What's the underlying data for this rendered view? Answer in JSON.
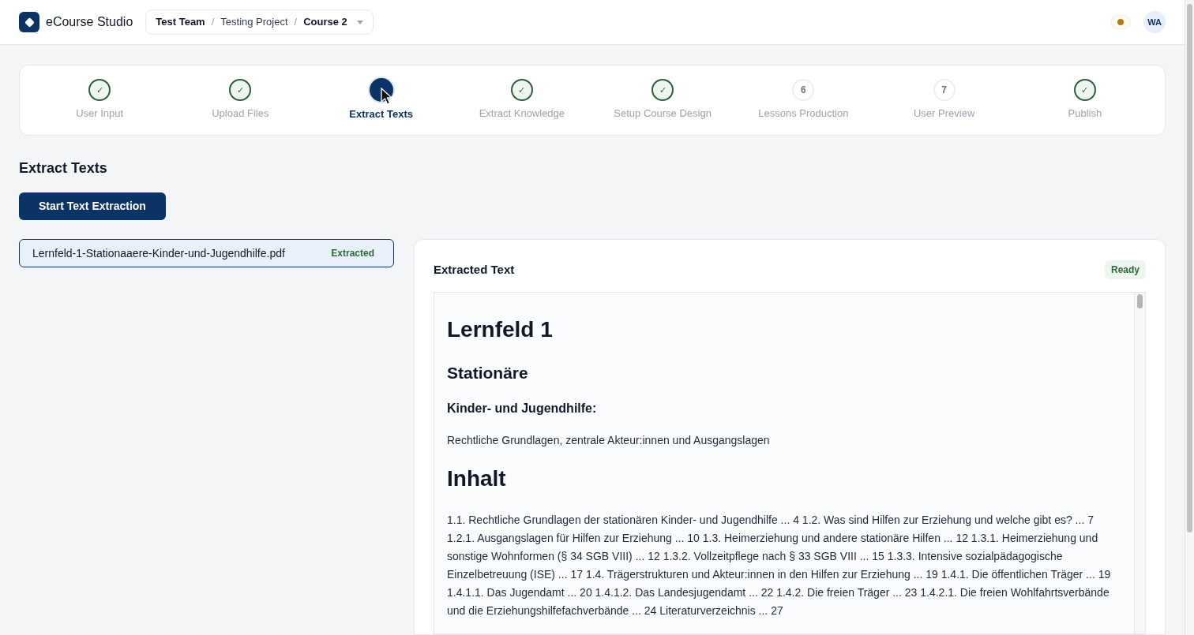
{
  "app": {
    "name": "eCourse Studio"
  },
  "breadcrumb": [
    {
      "kind": "crumb",
      "label": "Test Team",
      "bold": true
    },
    {
      "kind": "separator",
      "label": "/"
    },
    {
      "kind": "crumb",
      "label": "Testing Project",
      "bold": false
    },
    {
      "kind": "separator",
      "label": "/"
    },
    {
      "kind": "crumb",
      "label": "Course 2",
      "bold": true
    }
  ],
  "user": {
    "initials": "WA"
  },
  "steps": [
    {
      "label": "User Input",
      "kind": "done",
      "mark": "✓",
      "selected": false
    },
    {
      "label": "Upload Files",
      "kind": "done",
      "mark": "✓",
      "selected": false
    },
    {
      "label": "Extract Texts",
      "kind": "current",
      "selected": true
    },
    {
      "label": "Extract Knowledge",
      "kind": "done",
      "mark": "✓",
      "selected": false
    },
    {
      "label": "Setup Course Design",
      "kind": "done",
      "mark": "✓",
      "selected": false
    },
    {
      "label": "Lessons Production",
      "kind": "todo",
      "mark": "6",
      "selected": false
    },
    {
      "label": "User Preview",
      "kind": "todo",
      "mark": "7",
      "selected": false
    },
    {
      "label": "Publish",
      "kind": "done",
      "mark": "✓",
      "selected": false
    }
  ],
  "page_title": "Extract Texts",
  "primary_button": "Start Text Extraction",
  "files": [
    {
      "name": "Lernfeld-1-Stationaaere-Kinder-und-Jugendhilfe.pdf",
      "badge": "Extracted",
      "selected": true
    }
  ],
  "preview": {
    "title": "Extracted Text",
    "badge": "Ready",
    "blocks": [
      {
        "kind": "h1",
        "text": "Lernfeld 1"
      },
      {
        "kind": "h2",
        "text": "Stationäre"
      },
      {
        "kind": "h3",
        "text": "Kinder- und Jugendhilfe:"
      },
      {
        "kind": "p",
        "text": "Rechtliche Grundlagen, zentrale Akteur:innen und Ausgangslagen"
      },
      {
        "kind": "h1",
        "text": "Inhalt"
      },
      {
        "kind": "p",
        "text": "1.1. Rechtliche Grundlagen der stationären Kinder- und Jugendhilfe ... 4 1.2. Was sind Hilfen zur Erziehung und welche gibt es? ... 7 1.2.1. Ausgangslagen für Hilfen zur Erziehung ... 10 1.3. Heimerziehung und andere stationäre Hilfen ... 12 1.3.1. Heimerziehung und sonstige Wohnformen (§ 34 SGB VIII) ... 12 1.3.2. Vollzeitpflege nach § 33 SGB VIII ... 15 1.3.3. Intensive sozialpädagogische Einzelbetreuung (ISE) ... 17 1.4. Trägerstrukturen und Akteur:innen in den Hilfen zur Erziehung ... 19 1.4.1. Die öffentlichen Träger ... 19 1.4.1.1. Das Jugendamt ... 20 1.4.1.2. Das Landesjugendamt ... 22 1.4.2. Die freien Träger ... 23 1.4.2.1. Die freien Wohlfahrtsverbände und die Erziehungshilfefachverbände ... 24 Literaturverzeichnis ... 27"
      }
    ]
  }
}
